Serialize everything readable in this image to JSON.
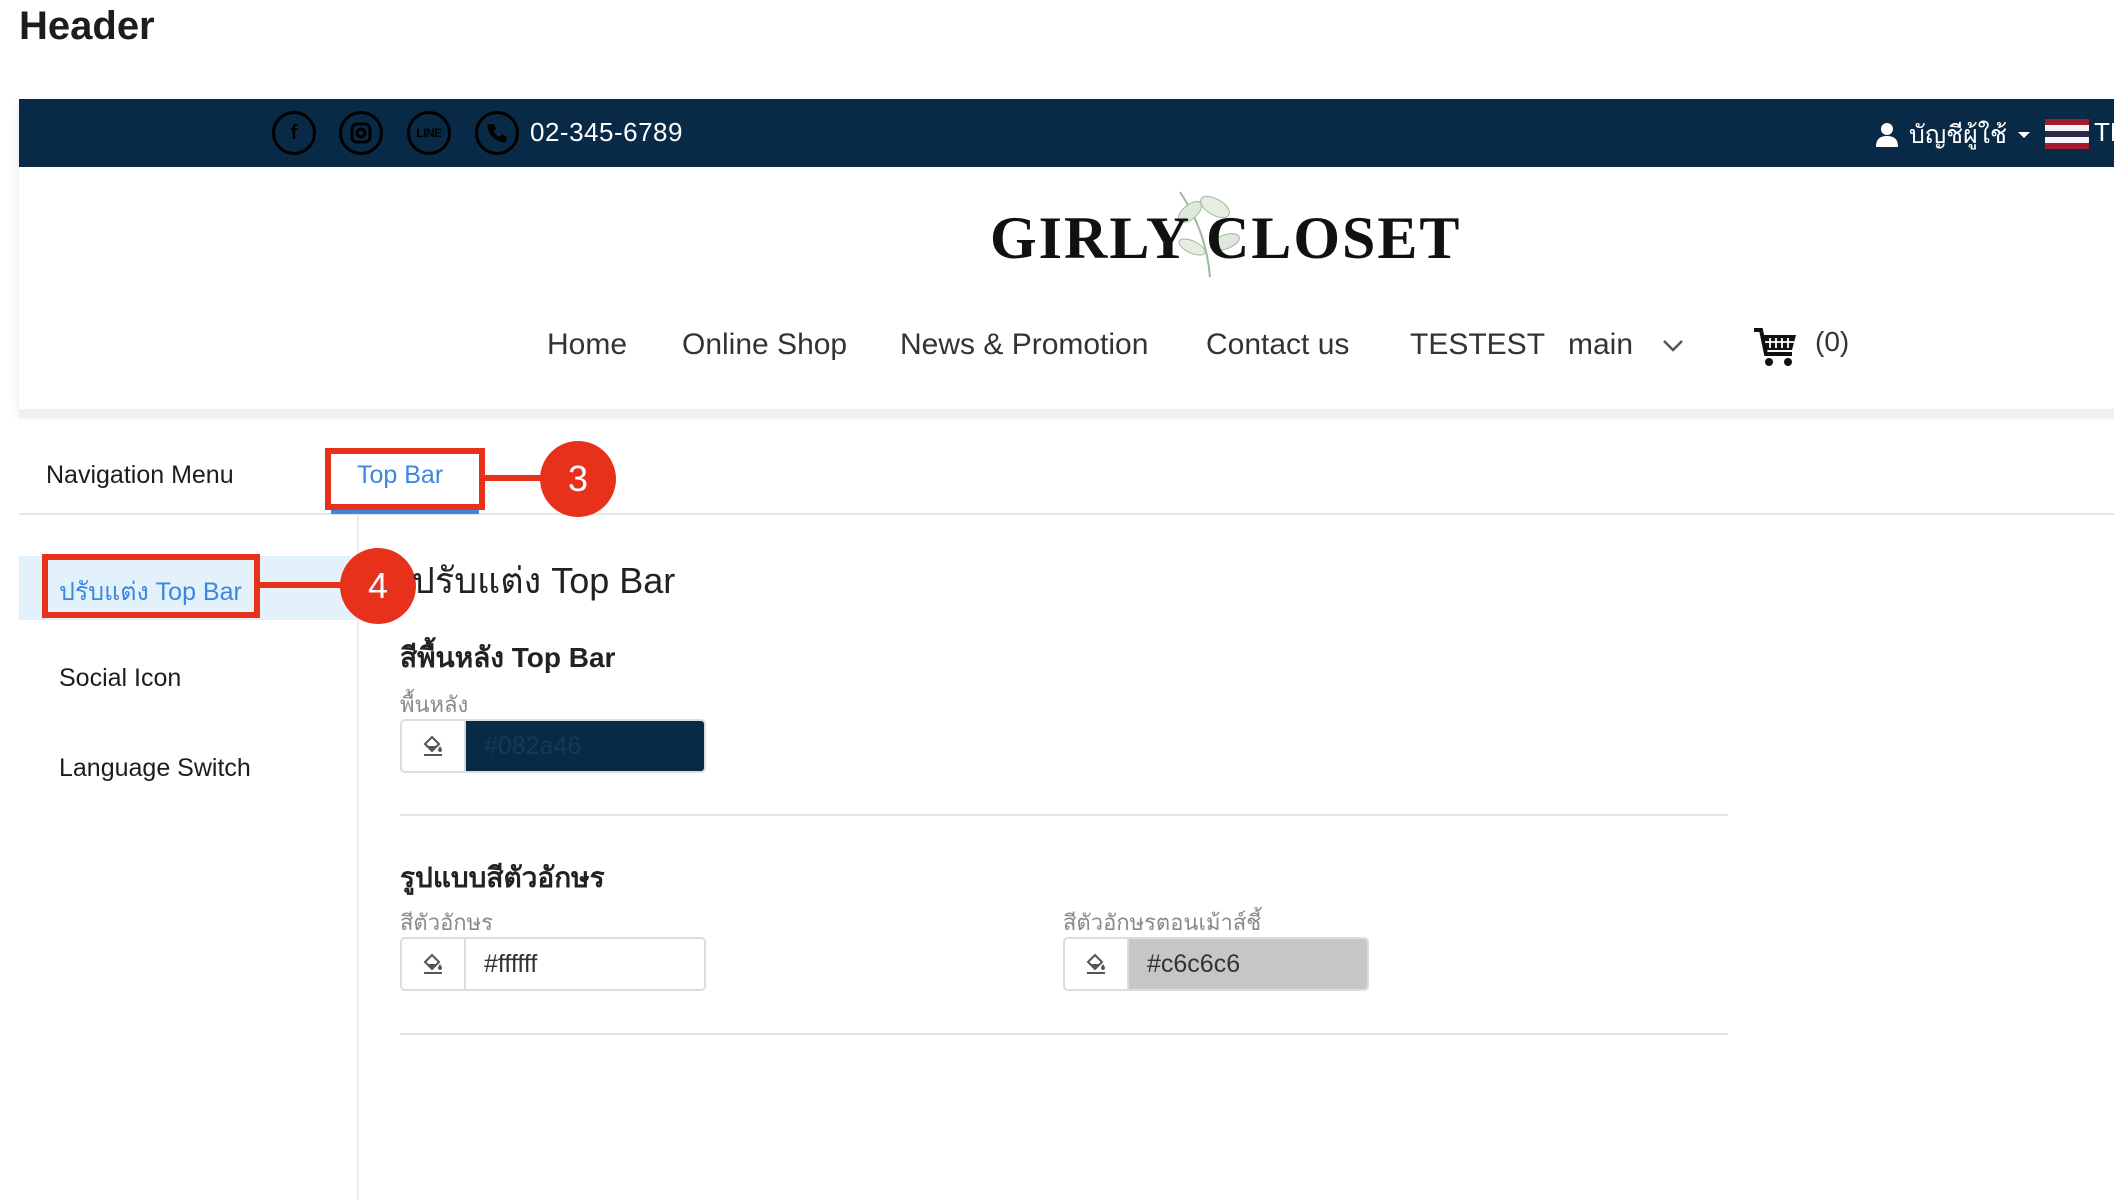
{
  "page": {
    "title": "Header"
  },
  "topbar": {
    "background": "#082a46",
    "text_color": "#ffffff",
    "social_icons": [
      "facebook-icon",
      "instagram-icon",
      "line-icon",
      "phone-icon"
    ],
    "social_glyphs": {
      "facebook": "f",
      "instagram": "◎",
      "line": "LINE",
      "phone": "✆"
    },
    "phone": "02-345-6789",
    "account_label": "บัญชีผู้ใช้",
    "language": "TH"
  },
  "store": {
    "logo_text": "GIRLY CLOSET",
    "nav": [
      "Home",
      "Online Shop",
      "News & Promotion",
      "Contact us",
      "TESTEST",
      "main"
    ],
    "cart_count": "(0)"
  },
  "tabs": [
    {
      "label": "Navigation Menu",
      "active": false
    },
    {
      "label": "Top Bar",
      "active": true
    }
  ],
  "callouts": {
    "tab": "3",
    "sidebar": "4"
  },
  "sidebar": {
    "items": [
      {
        "label": "ปรับแต่ง Top Bar",
        "active": true
      },
      {
        "label": "Social Icon",
        "active": false
      },
      {
        "label": "Language Switch",
        "active": false
      }
    ]
  },
  "content": {
    "title": "ปรับแต่ง Top Bar",
    "background_section": {
      "title": "สีพื้นหลัง Top Bar",
      "field_label": "พื้นหลัง",
      "value": "#082a46"
    },
    "text_section": {
      "title": "รูปแบบสีตัวอักษร",
      "text_color_label": "สีตัวอักษร",
      "text_color_value": "#ffffff",
      "hover_color_label": "สีตัวอักษรตอนเม้าส์ชี้",
      "hover_color_value": "#c6c6c6"
    }
  },
  "colors": {
    "accent_blue": "#3a88e0",
    "annotation_red": "#e8311a",
    "sidebar_active_bg": "#e3f1fb"
  }
}
